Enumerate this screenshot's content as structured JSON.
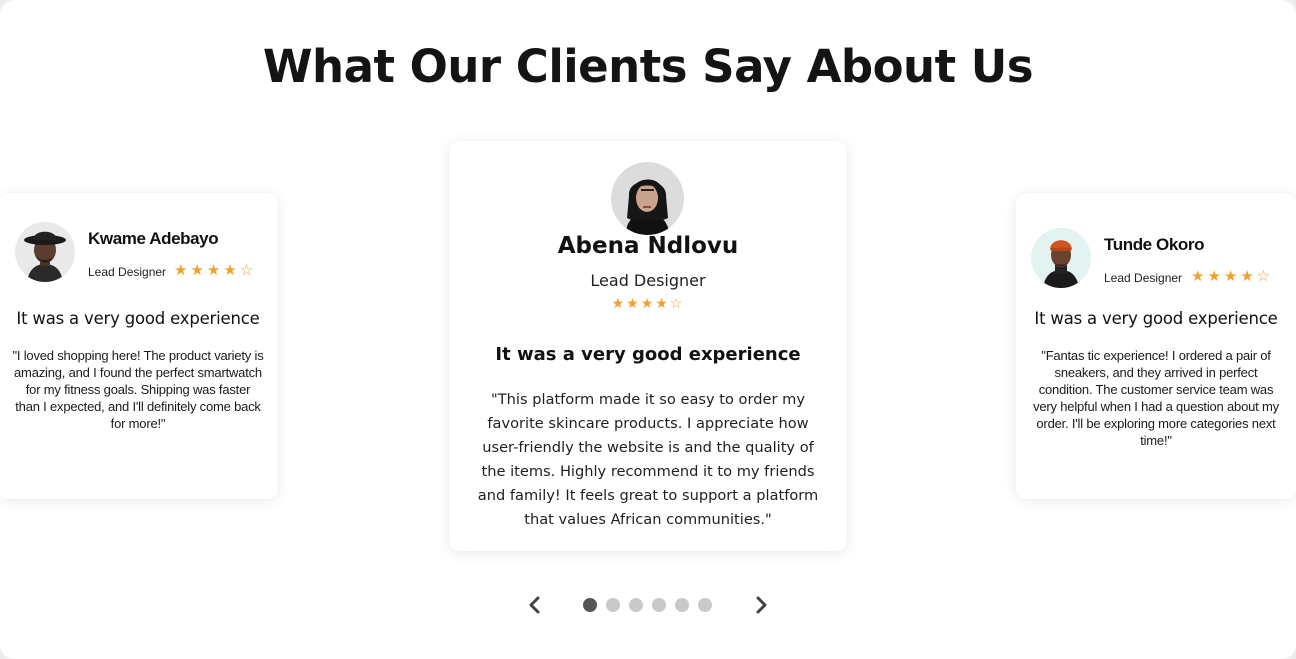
{
  "title": "What Our Clients Say About Us",
  "testimonials": {
    "left": {
      "name": "Kwame Adebayo",
      "role": "Lead Designer",
      "rating": 4,
      "headline": "It was a very good experience",
      "quote": "\"I loved shopping here! The product variety is amazing, and I found the perfect smartwatch for my fitness goals. Shipping was faster than I expected, and I'll definitely come back for more!\""
    },
    "center": {
      "name": "Abena Ndlovu",
      "role": "Lead Designer",
      "rating": 4,
      "headline": "It was a very good experience",
      "quote": "\"This platform made it so easy to order my favorite skincare products. I appreciate how user-friendly the website is and the quality of the items. Highly recommend it to my friends and family! It feels great to support a platform that values African communities.\""
    },
    "right": {
      "name": "Tunde Okoro",
      "role": "Lead Designer",
      "rating": 4,
      "headline": "It was a very good experience",
      "quote": "\"Fantas tic experience! I ordered a pair of sneakers, and they arrived in perfect condition. The customer service team was very helpful when I had a question about my order. I'll be exploring more categories next time!\""
    }
  },
  "star_icons": {
    "filled": "★",
    "empty": "☆",
    "max": 5
  },
  "carousel": {
    "prev_icon": "chevron-left-icon",
    "next_icon": "chevron-right-icon",
    "total_slides": 6,
    "active_index": 0
  },
  "colors": {
    "star": "#f0a02c",
    "dot_active": "#555555",
    "dot_inactive": "#c9c9c9",
    "heading": "#141414"
  }
}
